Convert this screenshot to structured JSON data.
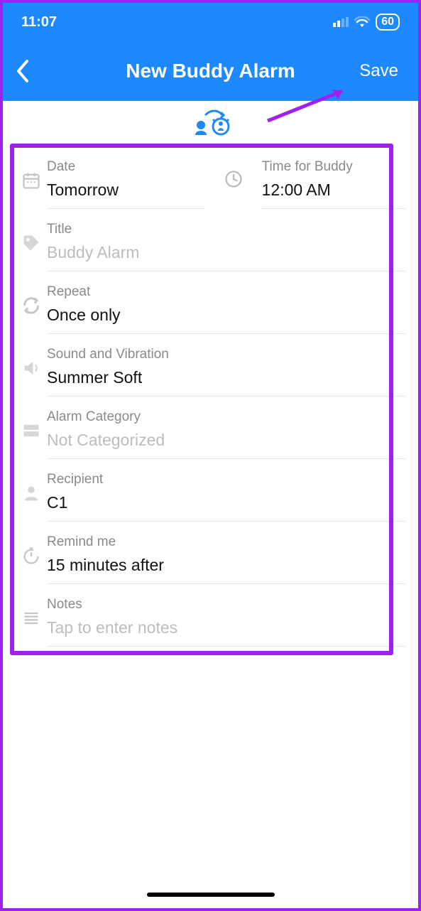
{
  "status": {
    "time": "11:07",
    "battery": "60"
  },
  "nav": {
    "title": "New Buddy Alarm",
    "save": "Save"
  },
  "fields": {
    "date": {
      "label": "Date",
      "value": "Tomorrow"
    },
    "time": {
      "label": "Time for Buddy",
      "value": "12:00 AM"
    },
    "title": {
      "label": "Title",
      "placeholder": "Buddy Alarm"
    },
    "repeat": {
      "label": "Repeat",
      "value": "Once only"
    },
    "sound": {
      "label": "Sound and Vibration",
      "value": "Summer Soft"
    },
    "category": {
      "label": "Alarm Category",
      "value": "Not Categorized",
      "placeholder_style": true
    },
    "recipient": {
      "label": "Recipient",
      "value": "C1"
    },
    "remind": {
      "label": "Remind me",
      "value": "15 minutes after"
    },
    "notes": {
      "label": "Notes",
      "placeholder": "Tap to enter notes"
    }
  }
}
